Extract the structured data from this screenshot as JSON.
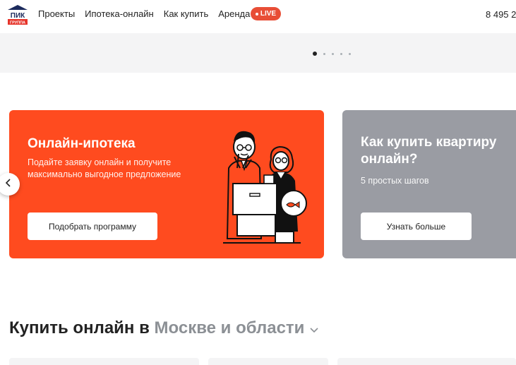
{
  "header": {
    "logo_text_top": "ПИК",
    "logo_text_bottom": "ГРУППА",
    "nav": [
      "Проекты",
      "Ипотека-онлайн",
      "Как купить",
      "Аренда"
    ],
    "live_label": "LIVE",
    "phone": "8 495 2"
  },
  "slider": {
    "dots_count": 5,
    "active_index": 0
  },
  "cards": [
    {
      "title": "Онлайн-ипотека",
      "subtitle": "Подайте заявку онлайн и получите максимально выгодное предложение",
      "button": "Подобрать программу",
      "color": "#ff4b1f"
    },
    {
      "title": "Как купить квартиру онлайн?",
      "subtitle": "5 простых шагов",
      "button": "Узнать больше",
      "color": "#9a9ca3"
    }
  ],
  "section": {
    "title_prefix": "Купить онлайн в ",
    "city": "Москве и области"
  },
  "icons": {
    "prev": "chevron-left-icon",
    "city_dropdown": "chevron-down-icon"
  }
}
